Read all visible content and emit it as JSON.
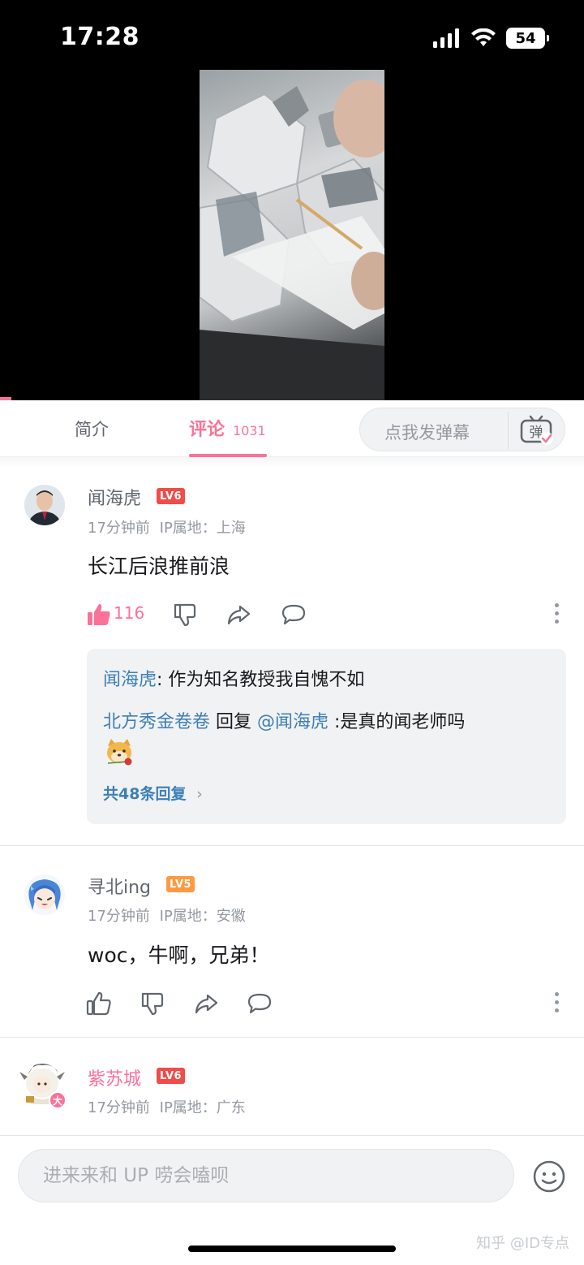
{
  "status_bar": {
    "time": "17:28",
    "battery": "54"
  },
  "tabs": {
    "intro": "简介",
    "comments": "评论",
    "comments_count": "1031"
  },
  "danmaku": {
    "placeholder": "点我发弹幕",
    "icon_label": "弹"
  },
  "comments": [
    {
      "username": "闻海虎",
      "level": "LV6",
      "time": "17分钟前",
      "ip": "IP属地：上海",
      "text": "长江后浪推前浪",
      "like_count": "116",
      "replies": [
        {
          "author": "闻海虎",
          "text": ": 作为知名教授我自愧不如"
        },
        {
          "author": "北方秀金卷卷",
          "action": " 回复 ",
          "mention": "@闻海虎",
          "text": " :是真的闻老师吗"
        }
      ],
      "more_replies": "共48条回复",
      "more_replies_chevron": "›"
    },
    {
      "username": "寻北ing",
      "level": "LV5",
      "time": "17分钟前",
      "ip": "IP属地：安徽",
      "text": "woc，牛啊，兄弟！"
    },
    {
      "username": "紫苏城",
      "level": "LV6",
      "time": "17分钟前",
      "ip": "IP属地：广东",
      "avatar_badge": "大"
    }
  ],
  "composer": {
    "placeholder": "进来来和 UP 唠会嗑呗"
  },
  "watermark": "知乎 @ID专点",
  "colors": {
    "accent": "#fb7299",
    "link": "#3d7fb6",
    "lv6": "#f04c49",
    "lv5": "#ff9a42"
  },
  "icons": [
    "signal-icon",
    "wifi-icon",
    "battery-icon",
    "danmaku-toggle-icon",
    "like-icon",
    "dislike-icon",
    "share-icon",
    "reply-icon",
    "more-icon",
    "emoji-icon"
  ]
}
